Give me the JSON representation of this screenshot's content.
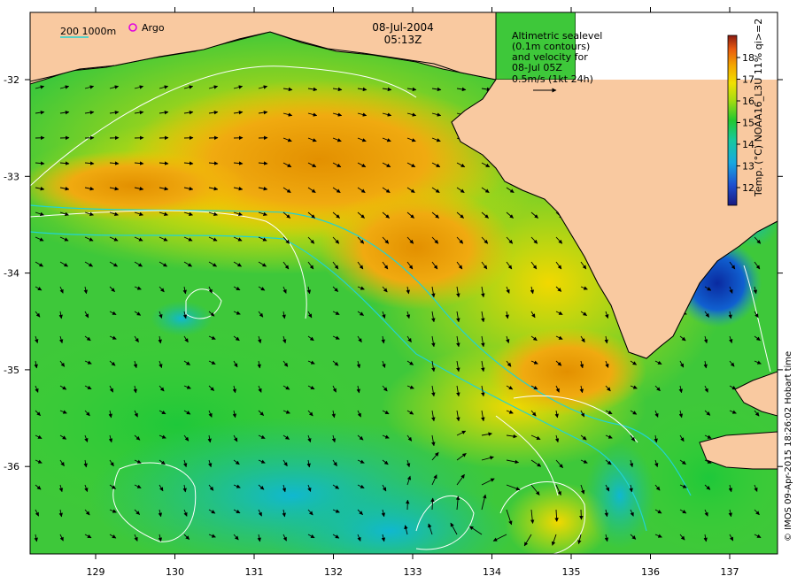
{
  "map": {
    "title_date": "08-Jul-2004",
    "title_time": "05:13Z",
    "depth_legend": "200  1000m",
    "argo_label": "Argo",
    "argo_color": "#e000e0",
    "altimetry_note": [
      "Altimetric sealevel",
      "(0.1m contours)",
      "and velocity for",
      "08-Jul 05Z",
      "0.5m/s (1kt 24h)"
    ],
    "credit": "© IMOS 09-Apr-2015 18:26:02 Hobart time",
    "colorbar_title": "Temp. (°C) NOAA16_L3U 11% qi>=2",
    "colorbar_ticks": [
      "12",
      "13",
      "14",
      "15",
      "16",
      "17",
      "18"
    ],
    "lon_ticks": [
      "129",
      "130",
      "131",
      "132",
      "133",
      "134",
      "135",
      "136",
      "137"
    ],
    "lat_ticks": [
      "-32",
      "-33",
      "-34",
      "-35",
      "-36"
    ],
    "land_color": "#f9c9a0",
    "isobath_color": "#22d3d3"
  }
}
